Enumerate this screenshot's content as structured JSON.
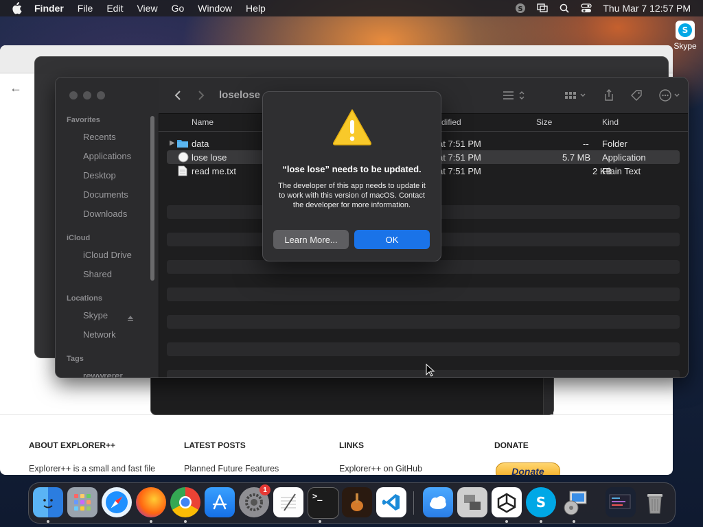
{
  "menubar": {
    "app": "Finder",
    "items": [
      "File",
      "Edit",
      "View",
      "Go",
      "Window",
      "Help"
    ],
    "datetime": "Thu Mar 7  12:57 PM"
  },
  "desktop": {
    "skype_label": "Skype"
  },
  "website": {
    "footer": {
      "about_head": "ABOUT EXPLORER++",
      "about_text": "Explorer++ is a small and fast file",
      "posts_head": "LATEST POSTS",
      "posts_text": "Planned Future Features",
      "links_head": "LINKS",
      "links_text": "Explorer++ on GitHub",
      "donate_head": "DONATE",
      "donate_button": "Donate"
    }
  },
  "finder": {
    "title": "loselose",
    "sidebar": {
      "favorites_head": "Favorites",
      "favorites": [
        "Recents",
        "Applications",
        "Desktop",
        "Documents",
        "Downloads"
      ],
      "icloud_head": "iCloud",
      "icloud": [
        "iCloud Drive",
        "Shared"
      ],
      "locations_head": "Locations",
      "locations": [
        "Skype",
        "Network"
      ],
      "tags_head": "Tags",
      "tags": [
        "rewwrerer"
      ]
    },
    "columns": {
      "name": "Name",
      "modified": "dified",
      "size": "Size",
      "kind": "Kind"
    },
    "files": [
      {
        "name": "data",
        "modified": "at 7:51 PM",
        "size": "--",
        "kind": "Folder"
      },
      {
        "name": "lose lose",
        "modified": "at 7:51 PM",
        "size": "5.7 MB",
        "kind": "Application"
      },
      {
        "name": "read me.txt",
        "modified": "at 7:51 PM",
        "size": "2 KB",
        "kind": "Plain Text"
      }
    ]
  },
  "alert": {
    "title": "“lose lose” needs to be updated.",
    "body": "The developer of this app needs to update it to work with this version of macOS. Contact the developer for more information.",
    "learn_more": "Learn More...",
    "ok": "OK"
  },
  "dock": {
    "apps": [
      "Finder",
      "Launchpad",
      "Safari",
      "Firefox",
      "Chrome",
      "App Store",
      "System Settings",
      "TextEdit",
      "Terminal",
      "GarageBand",
      "VS Code",
      "Weather",
      "Migration",
      "Unity",
      "Skype",
      "Installer",
      "Explorer",
      "Trash"
    ],
    "settings_badge": "1"
  }
}
